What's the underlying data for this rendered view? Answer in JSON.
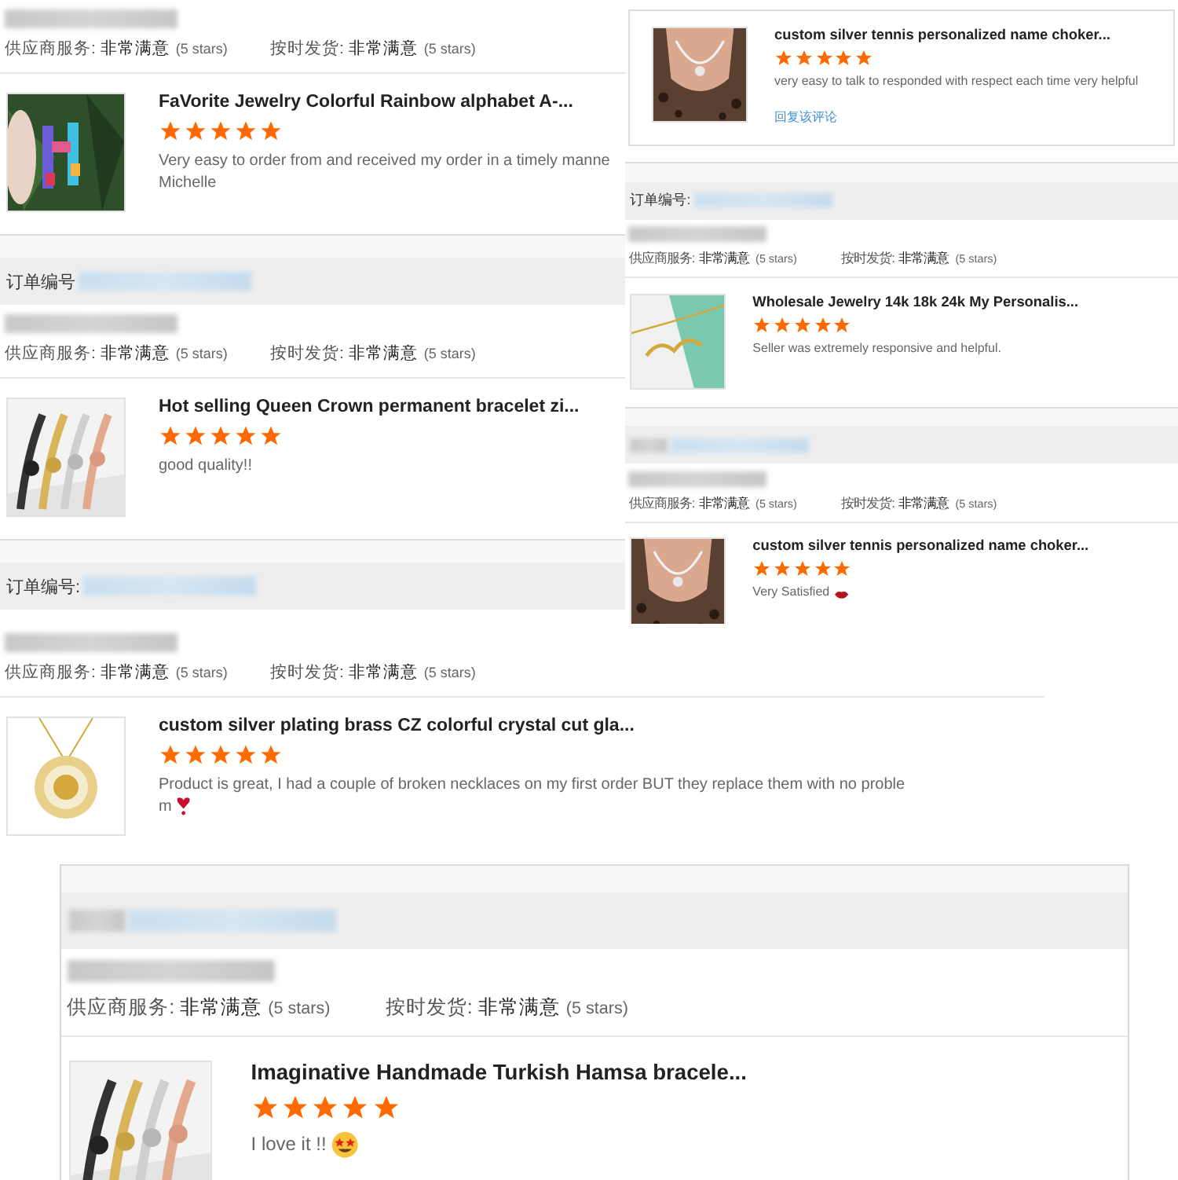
{
  "screenshots": [
    {
      "blocks": [
        {
          "kind": "ratings",
          "items": [
            {
              "label": "供应商服务:",
              "value": "非常满意",
              "note": "(5 stars)"
            },
            {
              "label": "按时发货:",
              "value": "非常满意",
              "note": "(5 stars)"
            }
          ]
        },
        {
          "kind": "product",
          "title": "FaVorite Jewelry Colorful Rainbow alphabet A-...",
          "stars": 5,
          "review": [
            "Very easy to order from and received my order in a timely manne",
            "Michelle"
          ]
        },
        {
          "kind": "order_header",
          "label": "订单编号"
        },
        {
          "kind": "ratings",
          "items": [
            {
              "label": "供应商服务:",
              "value": "非常满意",
              "note": "(5 stars)"
            },
            {
              "label": "按时发货:",
              "value": "非常满意",
              "note": "(5 stars)"
            }
          ]
        },
        {
          "kind": "product",
          "title": "Hot selling Queen Crown permanent bracelet zi...",
          "stars": 5,
          "review": [
            "good quality!!"
          ]
        },
        {
          "kind": "order_header",
          "label": "订单编号:"
        }
      ]
    },
    {
      "blocks": [
        {
          "kind": "product",
          "title": "custom silver tennis personalized name choker...",
          "stars": 5,
          "review": [
            "very easy to talk to responded with respect each time very helpful"
          ],
          "reply_link": "回复该评论"
        },
        {
          "kind": "order_header",
          "label": "订单编号:"
        },
        {
          "kind": "ratings",
          "items": [
            {
              "label": "供应商服务:",
              "value": "非常满意",
              "note": "(5 stars)"
            },
            {
              "label": "按时发货:",
              "value": "非常满意",
              "note": "(5 stars)"
            }
          ]
        },
        {
          "kind": "product",
          "title": "Wholesale Jewelry 14k 18k 24k My Personalis...",
          "stars": 5,
          "review": [
            "Seller was extremely responsive and helpful."
          ]
        },
        {
          "kind": "order_header"
        },
        {
          "kind": "ratings",
          "items": [
            {
              "label": "供应商服务:",
              "value": "非常满意",
              "note": "(5 stars)"
            },
            {
              "label": "按时发货:",
              "value": "非常满意",
              "note": "(5 stars)"
            }
          ]
        },
        {
          "kind": "product",
          "title": "custom silver tennis personalized name choker...",
          "stars": 5,
          "review": [
            "Very Satisfied"
          ]
        }
      ]
    },
    {
      "blocks": [
        {
          "kind": "ratings",
          "items": [
            {
              "label": "供应商服务:",
              "value": "非常满意",
              "note": "(5 stars)"
            },
            {
              "label": "按时发货:",
              "value": "非常满意",
              "note": "(5 stars)"
            }
          ]
        },
        {
          "kind": "product",
          "title": "custom silver plating brass CZ colorful crystal cut gla...",
          "stars": 5,
          "review": [
            "Product is great, I had a couple of broken necklaces on my first order BUT they replace them with no proble",
            "m"
          ]
        }
      ]
    },
    {
      "blocks": [
        {
          "kind": "order_header"
        },
        {
          "kind": "ratings",
          "items": [
            {
              "label": "供应商服务:",
              "value": "非常满意",
              "note": "(5 stars)"
            },
            {
              "label": "按时发货:",
              "value": "非常满意",
              "note": "(5 stars)"
            }
          ]
        },
        {
          "kind": "product",
          "title": "Imaginative Handmade Turkish Hamsa bracele...",
          "stars": 5,
          "review": [
            "I love it !!"
          ]
        }
      ]
    }
  ]
}
